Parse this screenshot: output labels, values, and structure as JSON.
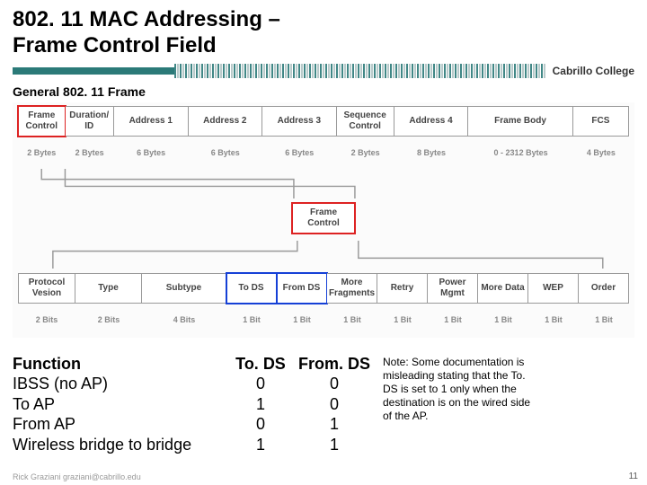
{
  "title_line1": "802. 11 MAC Addressing –",
  "title_line2": "Frame Control Field",
  "college": "Cabrillo College",
  "subhead": "General 802. 11 Frame",
  "frame_fields": [
    {
      "label": "Frame Control",
      "size": "2 Bytes",
      "wclass": "w-fc",
      "red": true
    },
    {
      "label": "Duration/ ID",
      "size": "2 Bytes",
      "wclass": "w-dur"
    },
    {
      "label": "Address 1",
      "size": "6 Bytes",
      "wclass": "w-addr"
    },
    {
      "label": "Address 2",
      "size": "6 Bytes",
      "wclass": "w-addr"
    },
    {
      "label": "Address 3",
      "size": "6 Bytes",
      "wclass": "w-addr"
    },
    {
      "label": "Sequence Control",
      "size": "2 Bytes",
      "wclass": "w-seq"
    },
    {
      "label": "Address 4",
      "size": "8 Bytes",
      "wclass": "w-addr"
    },
    {
      "label": "Frame Body",
      "size": "0 - 2312 Bytes",
      "wclass": "w-body"
    },
    {
      "label": "FCS",
      "size": "4 Bytes",
      "wclass": "w-fcs"
    }
  ],
  "fc_mid_label": "Frame Control",
  "control_fields": [
    {
      "label": "Protocol Vesion",
      "size": "2 Bits",
      "wclass": "cw-pv"
    },
    {
      "label": "Type",
      "size": "2 Bits",
      "wclass": "cw-ty"
    },
    {
      "label": "Subtype",
      "size": "4 Bits",
      "wclass": "cw-sub"
    },
    {
      "label": "To DS",
      "size": "1 Bit",
      "wclass": "cw-1",
      "blue": true
    },
    {
      "label": "From DS",
      "size": "1 Bit",
      "wclass": "cw-1",
      "blue": true
    },
    {
      "label": "More Fragments",
      "size": "1 Bit",
      "wclass": "cw-1"
    },
    {
      "label": "Retry",
      "size": "1 Bit",
      "wclass": "cw-1"
    },
    {
      "label": "Power Mgmt",
      "size": "1 Bit",
      "wclass": "cw-1"
    },
    {
      "label": "More Data",
      "size": "1 Bit",
      "wclass": "cw-1"
    },
    {
      "label": "WEP",
      "size": "1 Bit",
      "wclass": "cw-1"
    },
    {
      "label": "Order",
      "size": "1 Bit",
      "wclass": "cw-1"
    }
  ],
  "func_table": {
    "headers": [
      "Function",
      "To. DS",
      "From. DS"
    ],
    "rows": [
      [
        "IBSS (no AP)",
        "0",
        "0"
      ],
      [
        "To AP",
        "1",
        "0"
      ],
      [
        "From AP",
        "0",
        "1"
      ],
      [
        "Wireless bridge to bridge",
        "1",
        "1"
      ]
    ]
  },
  "note": "Note: Some documentation is misleading stating that the To. DS is set to 1 only when the destination is on the wired side of the AP.",
  "footer": "Rick Graziani graziani@cabrillo.edu",
  "pagenum": "11"
}
